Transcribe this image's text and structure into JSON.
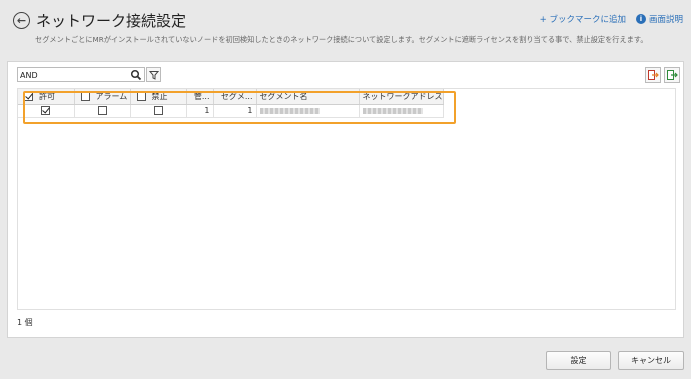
{
  "header": {
    "back_icon": "back-arrow-icon",
    "title": "ネットワーク接続設定",
    "add_bookmark": "+ ブックマークに追加",
    "help_icon": "info-icon",
    "help_label": "画面説明",
    "description": "セグメントごとにMRがインストールされていないノードを初回検知したときのネットワーク接続について設定します。セグメントに遮断ライセンスを割り当てる事で、禁止設定を行えます。"
  },
  "toolbar": {
    "search_value": "AND",
    "search_icon": "search-icon",
    "filter_icon": "filter-icon",
    "import_icon": "import-icon",
    "export_icon": "export-icon"
  },
  "grid": {
    "columns": [
      "許可",
      "アラーム",
      "禁止",
      "管...",
      "セグメ...",
      "セグメント名",
      "ネットワークアドレス"
    ],
    "header_checkboxes": {
      "allow": true,
      "alarm": false,
      "block": false
    },
    "rows": [
      {
        "allow": true,
        "alarm": false,
        "block": false,
        "mgmt": "1",
        "segment": "1"
      }
    ]
  },
  "status": {
    "count": "1 個"
  },
  "footer": {
    "ok_label": "設定",
    "cancel_label": "キャンセル"
  },
  "colors": {
    "link": "#2a6fb8",
    "highlight": "#f2a12b"
  }
}
